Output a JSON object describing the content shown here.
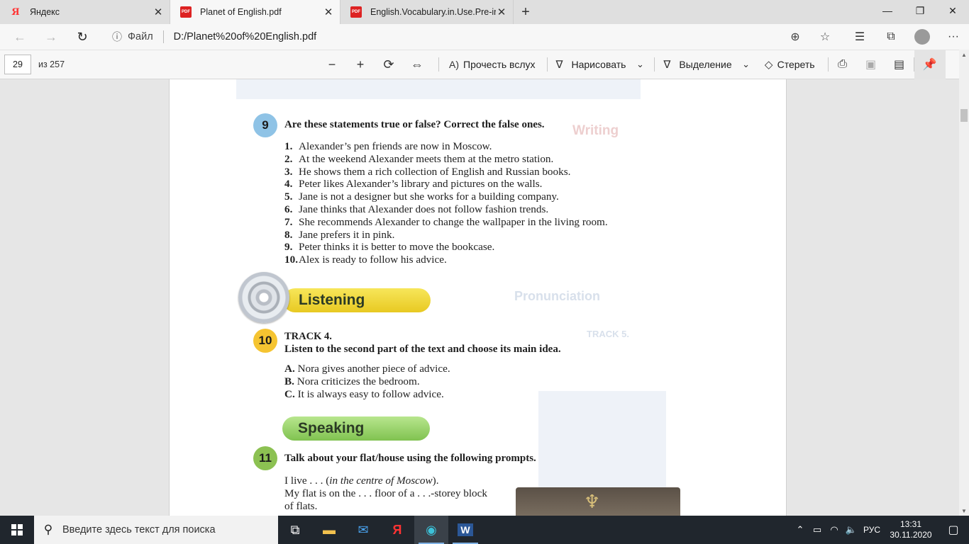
{
  "browser": {
    "tabs": [
      {
        "title": "Яндекс",
        "icon": "yandex-icon",
        "active": false
      },
      {
        "title": "Planet of English.pdf",
        "icon": "pdf-icon",
        "active": true
      },
      {
        "title": "English.Vocabulary.in.Use.Pre-int",
        "icon": "pdf-icon",
        "active": false
      }
    ],
    "address": {
      "scheme_label": "Файл",
      "url": "D:/Planet%20of%20English.pdf"
    }
  },
  "pdf_toolbar": {
    "page_number": "29",
    "page_count": "из 257",
    "read_aloud": "Прочесть вслух",
    "draw": "Нарисовать",
    "highlight": "Выделение",
    "erase": "Стереть"
  },
  "document": {
    "ex9": {
      "number": "9",
      "title": "Are these statements true or false? Correct the false ones.",
      "items": [
        {
          "n": "1.",
          "text": "Alexander’s pen friends are now in Moscow."
        },
        {
          "n": "2.",
          "text": "At the weekend Alexander meets them at the metro station."
        },
        {
          "n": "3.",
          "text": "He shows them a rich collection of English and Russian books."
        },
        {
          "n": "4.",
          "text": "Peter likes Alexander’s library and pictures on the walls."
        },
        {
          "n": "5.",
          "text": "Jane is not a designer but she works for a building company."
        },
        {
          "n": "6.",
          "text": "Jane thinks that Alexander does not follow fashion trends."
        },
        {
          "n": "7.",
          "text": "She recommends Alexander to change the wallpaper in the living room."
        },
        {
          "n": "8.",
          "text": "Jane prefers it in pink."
        },
        {
          "n": "9.",
          "text": "Peter thinks it is better to move the bookcase."
        },
        {
          "n": "10.",
          "text": "Alex is ready to follow his advice."
        }
      ]
    },
    "listening_banner": "Listening",
    "ex10": {
      "number": "10",
      "track": "TRACK 4.",
      "title": "Listen to the second part of the text and choose its main idea.",
      "options": [
        {
          "letter": "A.",
          "text": "Nora gives another piece of advice."
        },
        {
          "letter": "B.",
          "text": "Nora criticizes the bedroom."
        },
        {
          "letter": "C.",
          "text": "It is always easy to follow advice."
        }
      ]
    },
    "speaking_banner": "Speaking",
    "ex11": {
      "number": "11",
      "title": "Talk about your flat/house using the following prompts.",
      "line1_prefix": "I live . . . (",
      "line1_italic": "in the centre of Moscow",
      "line1_suffix": ").",
      "line2": "My flat is on the . . . floor of a . . .-storey block",
      "line3": "of flats."
    },
    "bleed": {
      "writing": "Writing",
      "pronunciation": "Pronunciation",
      "track5": "TRACK 5."
    }
  },
  "taskbar": {
    "search_placeholder": "Введите здесь текст для поиска",
    "language": "РУС",
    "time": "13:31",
    "date": "30.11.2020"
  },
  "colors": {
    "ex9_circle": "#8fc3e6",
    "ex10_circle": "#f5c431",
    "ex11_circle": "#8cc152",
    "listening_banner": "#f2d633",
    "speaking_banner": "#9fd374",
    "taskbar": "#20262d"
  }
}
